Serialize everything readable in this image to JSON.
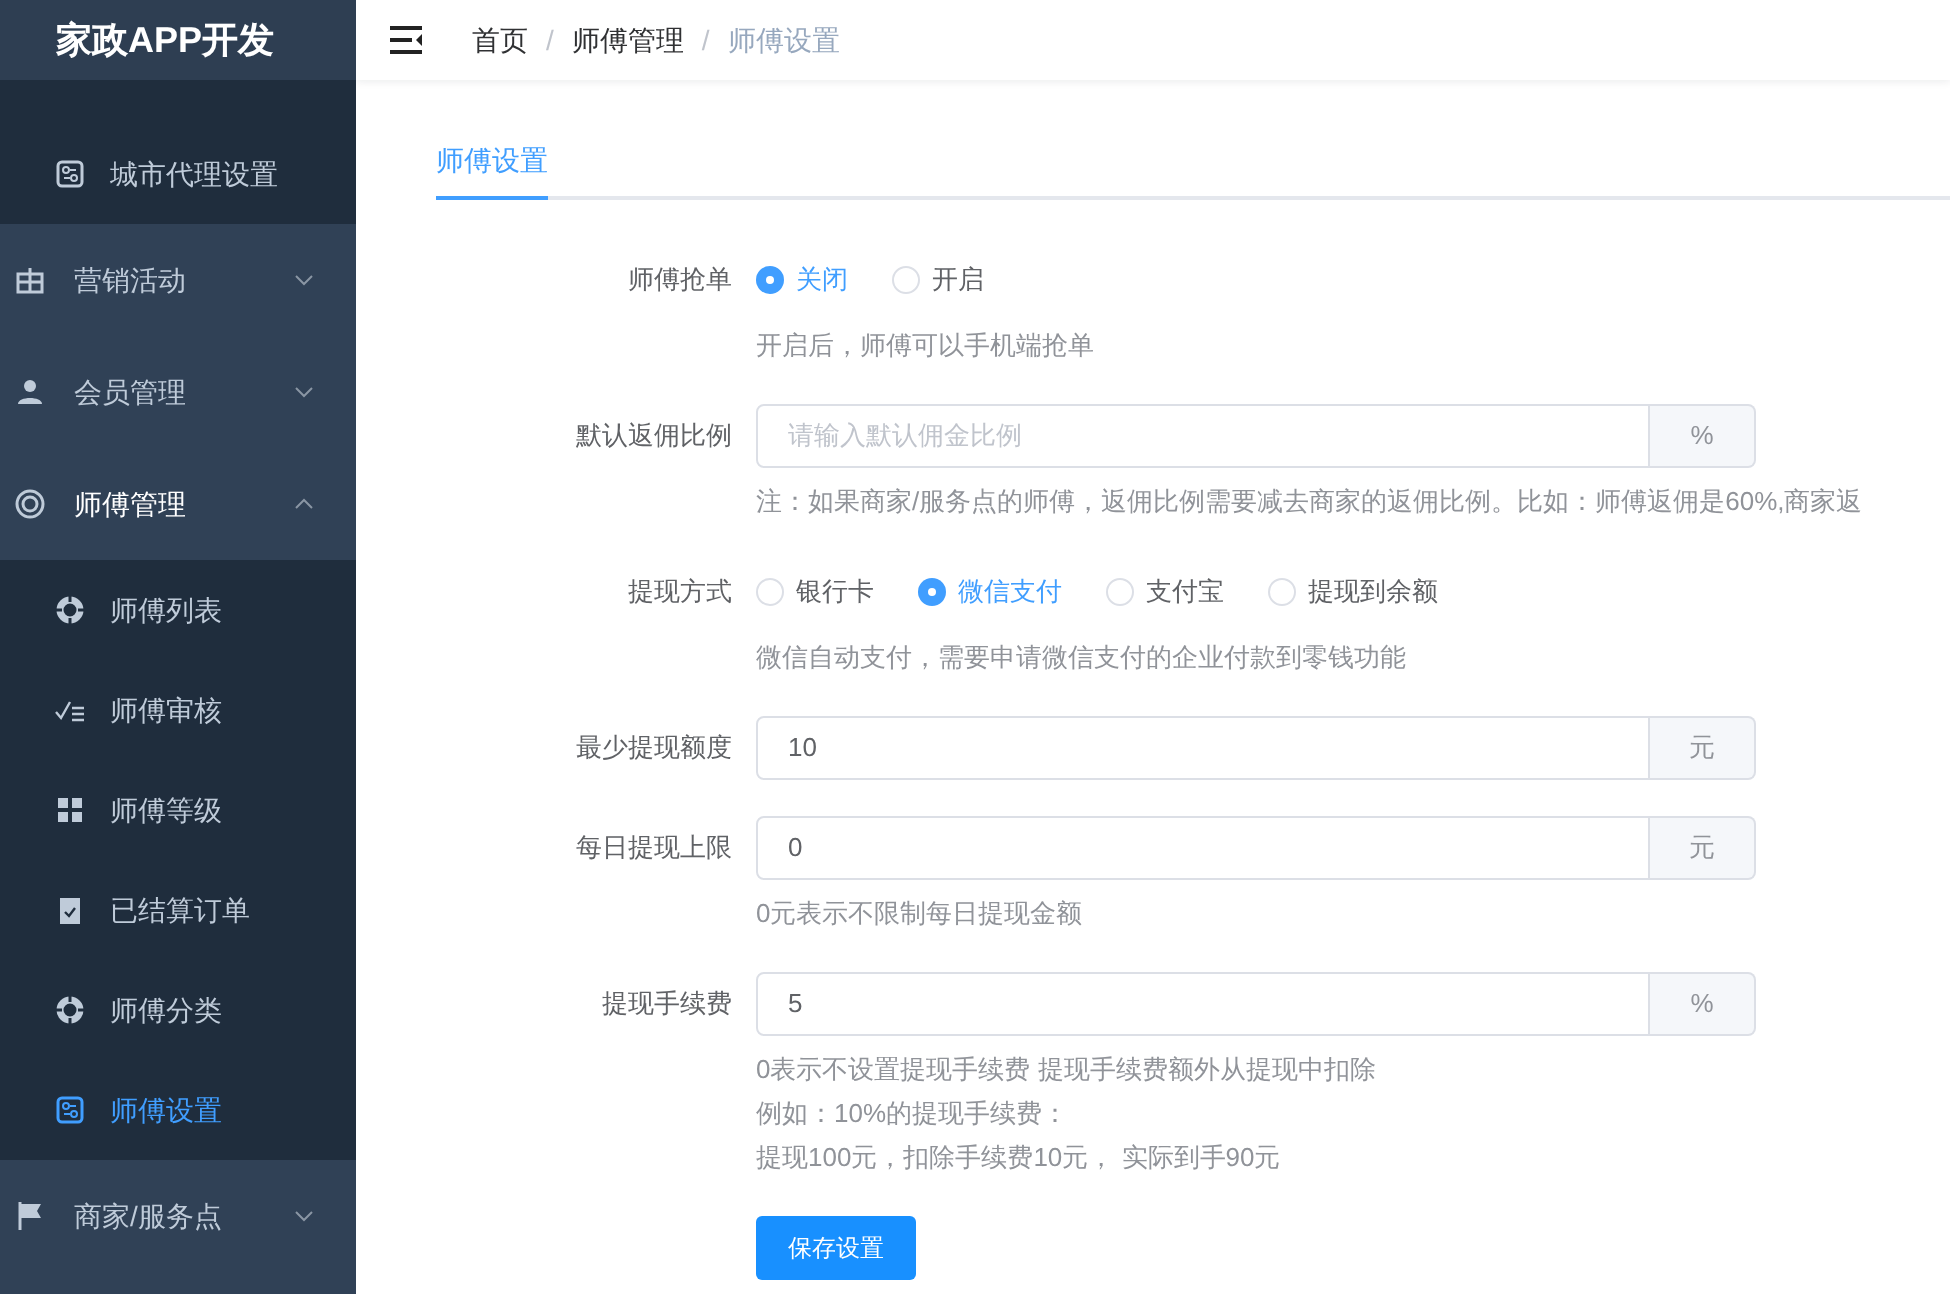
{
  "sidebar": {
    "logo": "家政APP开发",
    "items": [
      {
        "label": "城市代理设置",
        "kind": "sub",
        "selected": false
      },
      {
        "label": "营销活动",
        "kind": "group",
        "expanded": false
      },
      {
        "label": "会员管理",
        "kind": "group",
        "expanded": false
      },
      {
        "label": "师傅管理",
        "kind": "group",
        "expanded": true,
        "children": [
          {
            "label": "师傅列表",
            "selected": false
          },
          {
            "label": "师傅审核",
            "selected": false
          },
          {
            "label": "师傅等级",
            "selected": false
          },
          {
            "label": "已结算订单",
            "selected": false
          },
          {
            "label": "师傅分类",
            "selected": false
          },
          {
            "label": "师傅设置",
            "selected": true
          }
        ]
      },
      {
        "label": "商家/服务点",
        "kind": "group",
        "expanded": false
      }
    ]
  },
  "breadcrumb": [
    {
      "label": "首页",
      "current": false
    },
    {
      "label": "师傅管理",
      "current": false
    },
    {
      "label": "师傅设置",
      "current": true
    }
  ],
  "breadcrumb_separator": "/",
  "tabs": [
    {
      "label": "师傅设置",
      "selected": true
    }
  ],
  "form": [
    {
      "kind": "radio",
      "label": "师傅抢单",
      "options": [
        {
          "label": "关闭",
          "selected": true
        },
        {
          "label": "开启",
          "selected": false
        }
      ],
      "hints": [
        "开启后，师傅可以手机端抢单"
      ]
    },
    {
      "kind": "input",
      "label": "默认返佣比例",
      "placeholder": "请输入默认佣金比例",
      "unit": "%",
      "hints": [
        "注：如果商家/服务点的师傅，返佣比例需要减去商家的返佣比例。比如：师傅返佣是60%,商家返"
      ]
    },
    {
      "kind": "radio",
      "label": "提现方式",
      "options": [
        {
          "label": "银行卡",
          "selected": false
        },
        {
          "label": "微信支付",
          "selected": true
        },
        {
          "label": "支付宝",
          "selected": false
        },
        {
          "label": "提现到余额",
          "selected": false
        }
      ],
      "hints": [
        "微信自动支付，需要申请微信支付的企业付款到零钱功能"
      ]
    },
    {
      "kind": "input",
      "label": "最少提现额度",
      "value": "10",
      "unit": "元"
    },
    {
      "kind": "input",
      "label": "每日提现上限",
      "value": "0",
      "unit": "元",
      "hints": [
        "0元表示不限制每日提现金额"
      ]
    },
    {
      "kind": "input",
      "label": "提现手续费",
      "value": "5",
      "unit": "%",
      "hints": [
        "0表示不设置提现手续费 提现手续费额外从提现中扣除",
        "例如：10%的提现手续费：",
        "提现100元，扣除手续费10元， 实际到手90元"
      ]
    }
  ],
  "save_button": "保存设置"
}
